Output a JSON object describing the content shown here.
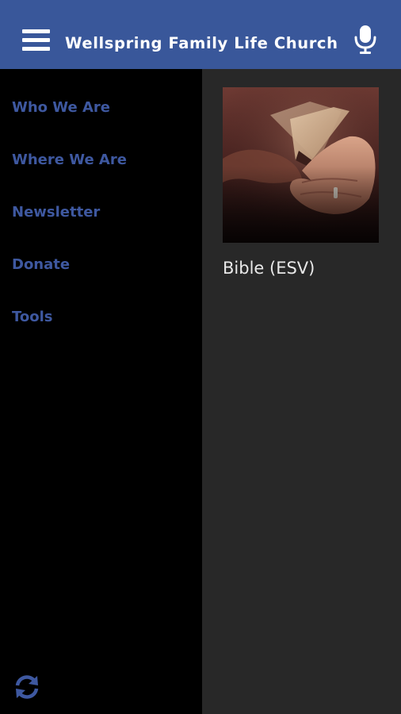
{
  "header": {
    "title": "Wellspring Family Life Church",
    "background_color": "#39579a",
    "menu_icon": "hamburger-menu-icon",
    "mic_icon": "microphone-icon"
  },
  "sidebar": {
    "text_color": "#3e58a0",
    "items": [
      {
        "label": "Who We Are"
      },
      {
        "label": "Where We Are"
      },
      {
        "label": "Newsletter"
      },
      {
        "label": "Donate"
      },
      {
        "label": "Tools"
      }
    ],
    "refresh_icon": "refresh-icon"
  },
  "main": {
    "tiles": [
      {
        "label": "Bible (ESV)",
        "image": "hands-holding-bible-photo"
      }
    ]
  }
}
